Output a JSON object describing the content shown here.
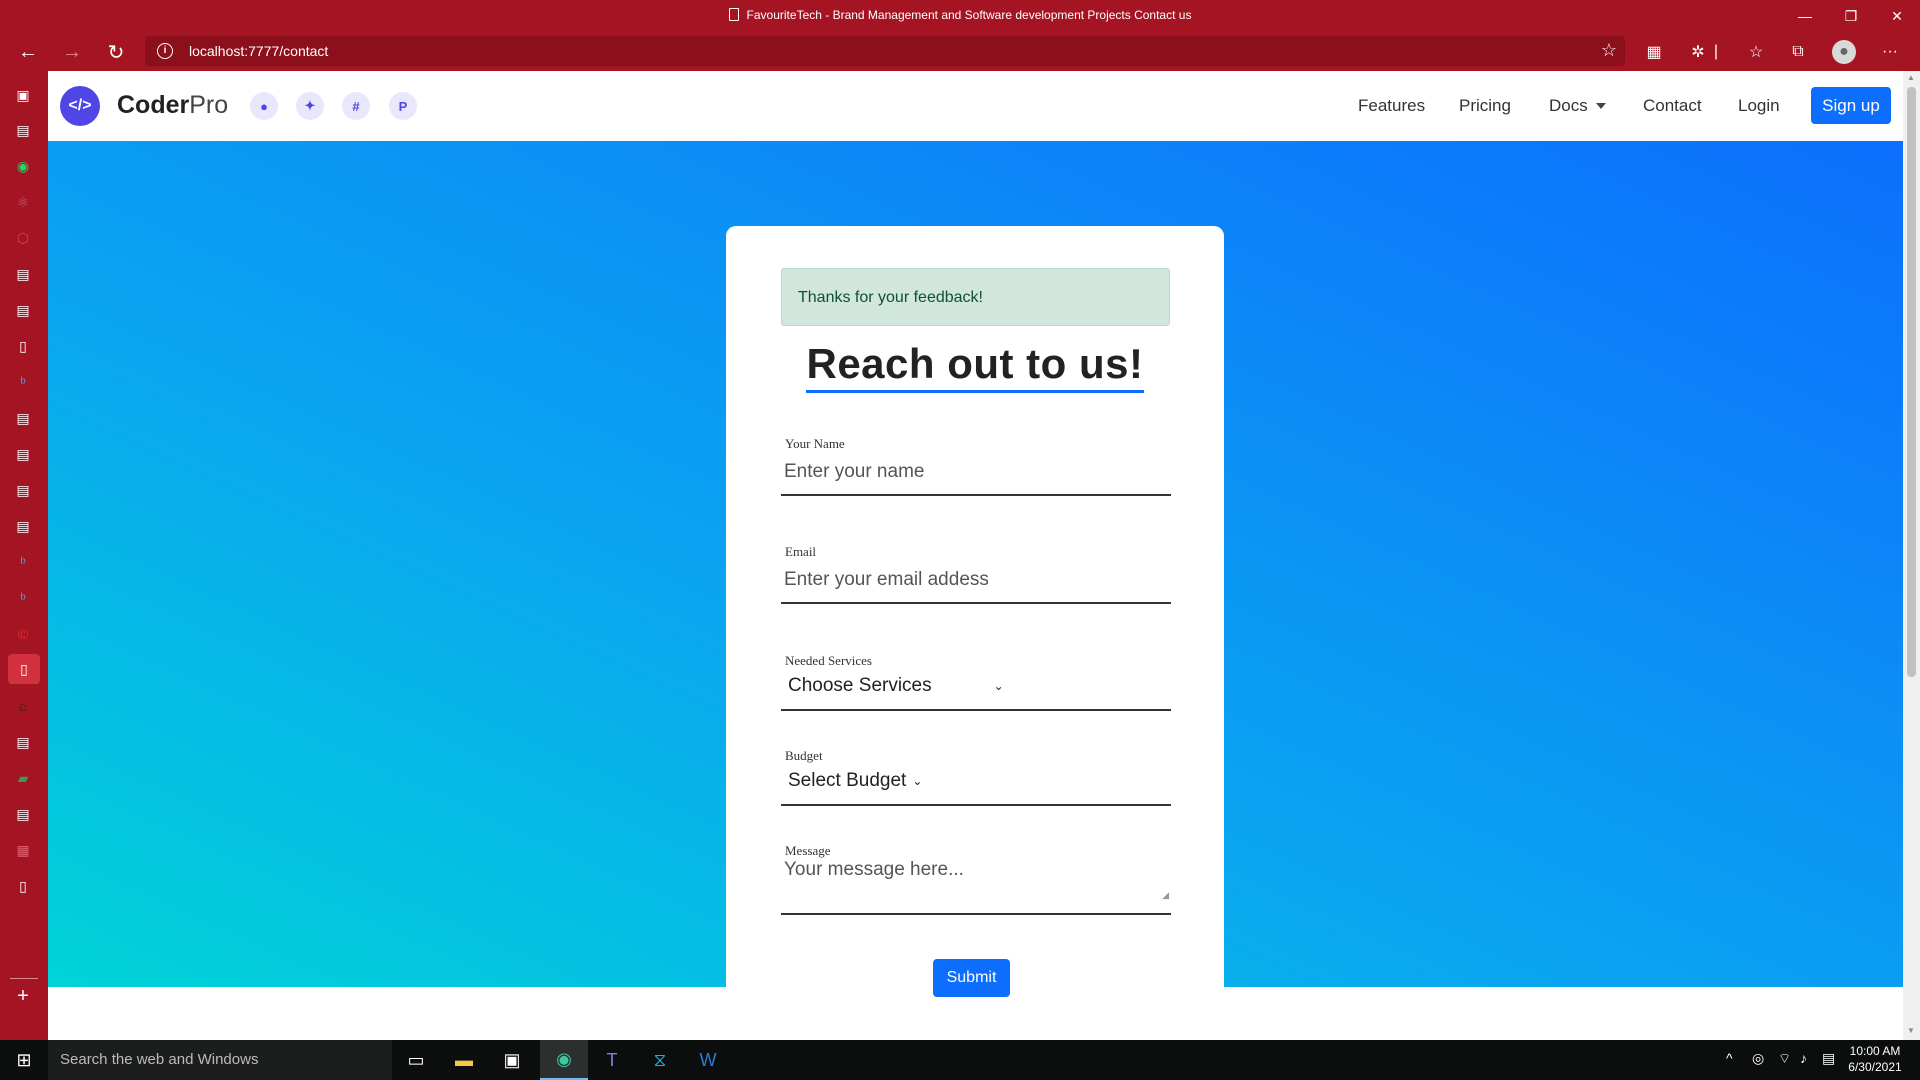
{
  "browser": {
    "window_title": "FavouriteTech - Brand Management and Software development Projects Contact us",
    "url": "localhost:7777/contact"
  },
  "site": {
    "brand_bold": "Coder",
    "brand_light": "Pro",
    "logo_glyph": "</>",
    "nav": {
      "features": "Features",
      "pricing": "Pricing",
      "docs": "Docs",
      "contact": "Contact",
      "login": "Login",
      "signup": "Sign up"
    },
    "social_icons": [
      "github-icon",
      "twitter-icon",
      "slack-icon",
      "producthunt-icon"
    ]
  },
  "contact_form": {
    "alert": "Thanks for your feedback!",
    "heading": "Reach out to us!",
    "name_label": "Your Name",
    "name_placeholder": "Enter your name",
    "email_label": "Email",
    "email_placeholder": "Enter your email addess",
    "services_label": "Needed Services",
    "services_selected": "Choose Services",
    "budget_label": "Budget",
    "budget_selected": "Select Budget",
    "message_label": "Message",
    "message_placeholder": "Your message here...",
    "submit": "Submit"
  },
  "taskbar": {
    "search_placeholder": "Search the web and Windows",
    "time": "10:00 AM",
    "date": "6/30/2021"
  },
  "colors": {
    "browser_chrome": "#a51423",
    "primary": "#0d6efd",
    "logo": "#4f46e5",
    "alert_bg": "#d1e7dd"
  }
}
